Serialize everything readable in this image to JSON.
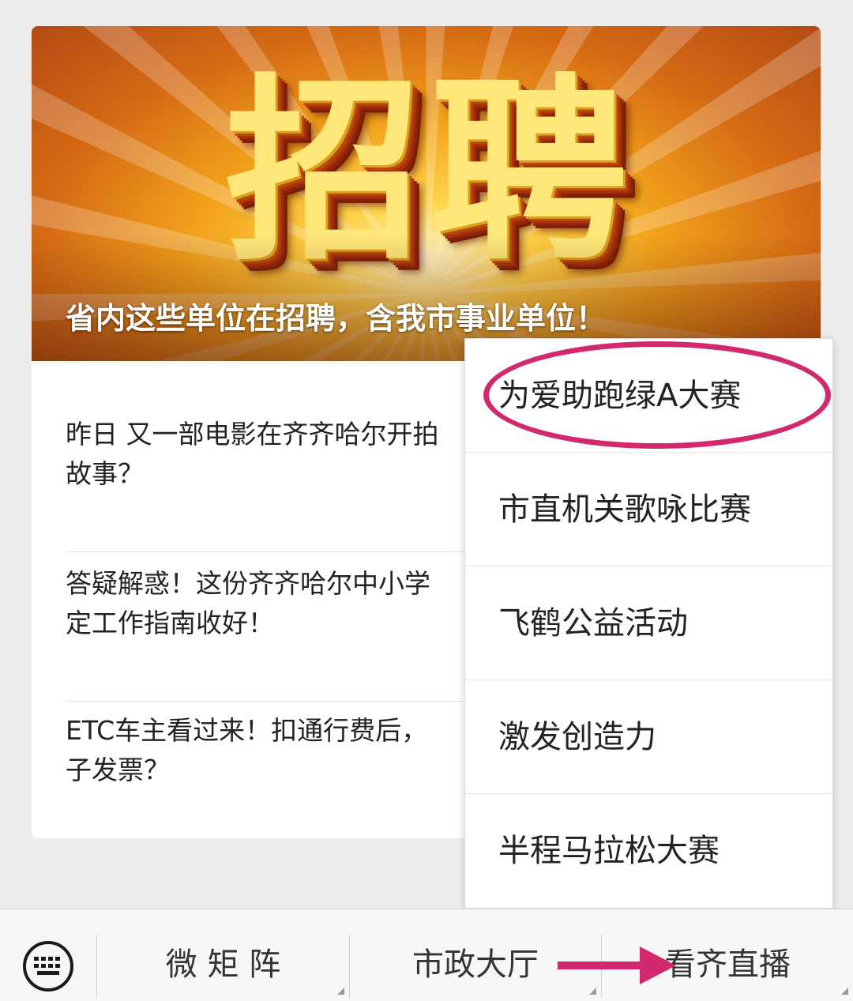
{
  "banner": {
    "big_word": "招聘",
    "headline": "省内这些单位在招聘，含我市事业单位！"
  },
  "articles": [
    {
      "line1": "昨日 又一部电影在齐齐哈尔开拍",
      "line2": "故事？"
    },
    {
      "line1": "答疑解惑！这份齐齐哈尔中小学",
      "line2": "定工作指南收好！"
    },
    {
      "line1": "ETC车主看过来！扣通行费后，",
      "line2": "子发票？"
    }
  ],
  "popup_menu": {
    "items": [
      {
        "label": "为爱助跑绿A大赛",
        "highlighted": true
      },
      {
        "label": "市直机关歌咏比赛"
      },
      {
        "label": "飞鹤公益活动"
      },
      {
        "label": "激发创造力"
      },
      {
        "label": "半程马拉松大赛"
      }
    ]
  },
  "bottom_menu": {
    "keyboard_icon": "keyboard-icon",
    "items": [
      {
        "label": "微 矩 阵"
      },
      {
        "label": "市政大厅"
      },
      {
        "label": "看齐直播"
      }
    ]
  },
  "colors": {
    "annotation": "#d2286e",
    "background": "#ededed"
  }
}
